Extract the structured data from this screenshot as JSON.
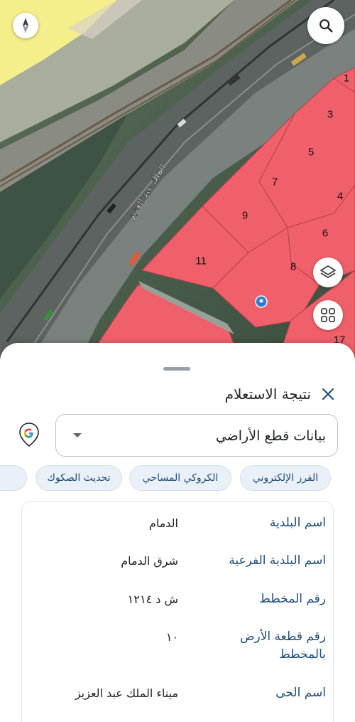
{
  "map": {
    "parcels": [
      {
        "id": "p1",
        "label": "1"
      },
      {
        "id": "p3",
        "label": "3"
      },
      {
        "id": "p5",
        "label": "5"
      },
      {
        "id": "p7",
        "label": "7"
      },
      {
        "id": "p4",
        "label": "4"
      },
      {
        "id": "p9",
        "label": "9"
      },
      {
        "id": "p6",
        "label": "6"
      },
      {
        "id": "p11",
        "label": "11"
      },
      {
        "id": "p8",
        "label": "8"
      },
      {
        "id": "p17",
        "label": "17"
      }
    ],
    "road_label": "الملك عبد العزيز",
    "parcel_color": "#f0606a"
  },
  "sheet": {
    "title": "نتيجة الاستعلام",
    "select_value": "بيانات قطع الأراضي",
    "chips": [
      "الفرز الإلكتروني",
      "الكروكي المساحي",
      "تحديث الصكوك",
      ""
    ],
    "rows": [
      {
        "label": "اسم البلدية",
        "value": "الدمام"
      },
      {
        "label": "اسم البلدية الفرعية",
        "value": "شرق الدمام"
      },
      {
        "label": "رقم المخطط",
        "value": "ش د ١٢١٤"
      },
      {
        "label": "رقم قطعة الأرض بالمخطط",
        "value": "١٠"
      },
      {
        "label": "اسم الحى",
        "value": "ميناء الملك عبد العزيز"
      }
    ]
  },
  "icons": {
    "search": "search-icon",
    "compass": "compass-icon",
    "layers": "layers-icon",
    "grid": "grid-icon",
    "close": "close-icon",
    "google": "google-logo-icon",
    "pin": "location-pin-icon"
  },
  "colors": {
    "accent": "#1f4c7a",
    "chip_bg": "#eaf0f7",
    "parcel": "#f0606a",
    "sand": "#f4ef8a"
  }
}
